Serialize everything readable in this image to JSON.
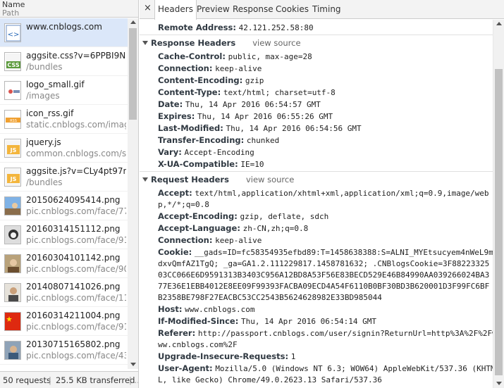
{
  "left": {
    "header_name": "Name",
    "header_path": "Path",
    "requests": [
      {
        "name": "www.cnblogs.com",
        "path": "",
        "icon": "html-doc-icon",
        "selected": true
      },
      {
        "name": "aggsite.css?v=6PPBI9N2x...",
        "path": "/bundles",
        "icon": "css-file-icon"
      },
      {
        "name": "logo_small.gif",
        "path": "/images",
        "icon": "logo-image-icon"
      },
      {
        "name": "icon_rss.gif",
        "path": "static.cnblogs.com/images",
        "icon": "rss-image-icon"
      },
      {
        "name": "jquery.js",
        "path": "common.cnblogs.com/sc...",
        "icon": "js-file-icon"
      },
      {
        "name": "aggsite.js?v=CLy4pt97nkl...",
        "path": "/bundles",
        "icon": "js-file-icon"
      },
      {
        "name": "20150624095414.png",
        "path": "pic.cnblogs.com/face/777...",
        "icon": "avatar-image-icon"
      },
      {
        "name": "20160314151112.png",
        "path": "pic.cnblogs.com/face/911...",
        "icon": "avatar-image-icon"
      },
      {
        "name": "20160304101142.png",
        "path": "pic.cnblogs.com/face/903...",
        "icon": "avatar-image-icon"
      },
      {
        "name": "20140807141026.png",
        "path": "pic.cnblogs.com/face/118...",
        "icon": "avatar-image-icon"
      },
      {
        "name": "20160314211004.png",
        "path": "pic.cnblogs.com/face/913...",
        "icon": "avatar-image-icon"
      },
      {
        "name": "20130715165802.png",
        "path": "pic.cnblogs.com/face/435...",
        "icon": "avatar-image-icon"
      }
    ],
    "status_requests": "50 requests",
    "status_sep": "|",
    "status_transferred": "25.5 KB transferred",
    "status_sep2": "|..."
  },
  "tabs": {
    "close": "×",
    "items": [
      "Headers",
      "Preview",
      "Response",
      "Cookies",
      "Timing"
    ],
    "active": "Headers"
  },
  "general": {
    "remote_address_key": "Remote Address:",
    "remote_address_val": "42.121.252.58:80"
  },
  "response_headers": {
    "title": "Response Headers",
    "view_source": "view source",
    "items": [
      {
        "k": "Cache-Control:",
        "v": "public, max-age=28"
      },
      {
        "k": "Connection:",
        "v": "keep-alive"
      },
      {
        "k": "Content-Encoding:",
        "v": "gzip"
      },
      {
        "k": "Content-Type:",
        "v": "text/html; charset=utf-8"
      },
      {
        "k": "Date:",
        "v": "Thu, 14 Apr 2016 06:54:57 GMT"
      },
      {
        "k": "Expires:",
        "v": "Thu, 14 Apr 2016 06:55:26 GMT"
      },
      {
        "k": "Last-Modified:",
        "v": "Thu, 14 Apr 2016 06:54:56 GMT"
      },
      {
        "k": "Transfer-Encoding:",
        "v": "chunked"
      },
      {
        "k": "Vary:",
        "v": "Accept-Encoding"
      },
      {
        "k": "X-UA-Compatible:",
        "v": "IE=10"
      }
    ]
  },
  "request_headers": {
    "title": "Request Headers",
    "view_source": "view source",
    "accept_k": "Accept:",
    "accept_v1": "text/html,application/xhtml+xml,application/xml;q=0.9,image/web",
    "accept_v2": "p,*/*;q=0.8",
    "accept_encoding_k": "Accept-Encoding:",
    "accept_encoding_v": "gzip, deflate, sdch",
    "accept_language_k": "Accept-Language:",
    "accept_language_v": "zh-CN,zh;q=0.8",
    "connection_k": "Connection:",
    "connection_v": "keep-alive",
    "cookie_k": "Cookie:",
    "cookie_v1": "__gads=ID=fc58354935efbd89:T=1458638388:S=ALNI_MYEtsucyem4nWeL9m",
    "cookie_v2": "dxvQmfAZ1TgQ; _ga=GA1.2.111229817.1458781632; .CNBlogsCookie=3F88223325",
    "cookie_v3": "03CC066E6D9591313B3403C956A12BD8A53F56E83BECD529E46B84990AA039266024BA3",
    "cookie_v4": "77E36E1EBB4012E8EE09F99393FACBA09ECD4A54F6110B0BF30BD3B620001D3F99FC6BF",
    "cookie_v5": "B2358BE798F27EACBC53CC2543B5624628982E33BD985044",
    "host_k": "Host:",
    "host_v": "www.cnblogs.com",
    "ims_k": "If-Modified-Since:",
    "ims_v": "Thu, 14 Apr 2016 06:54:14 GMT",
    "referer_k": "Referer:",
    "referer_v1": "http://passport.cnblogs.com/user/signin?ReturnUrl=http%3A%2F%2Fw",
    "referer_v2": "ww.cnblogs.com%2F",
    "uir_k": "Upgrade-Insecure-Requests:",
    "uir_v": "1",
    "ua_k": "User-Agent:",
    "ua_v1": "Mozilla/5.0 (Windows NT 6.3; WOW64) AppleWebKit/537.36 (KHTM",
    "ua_v2": "L, like Gecko) Chrome/49.0.2623.13 Safari/537.36"
  }
}
